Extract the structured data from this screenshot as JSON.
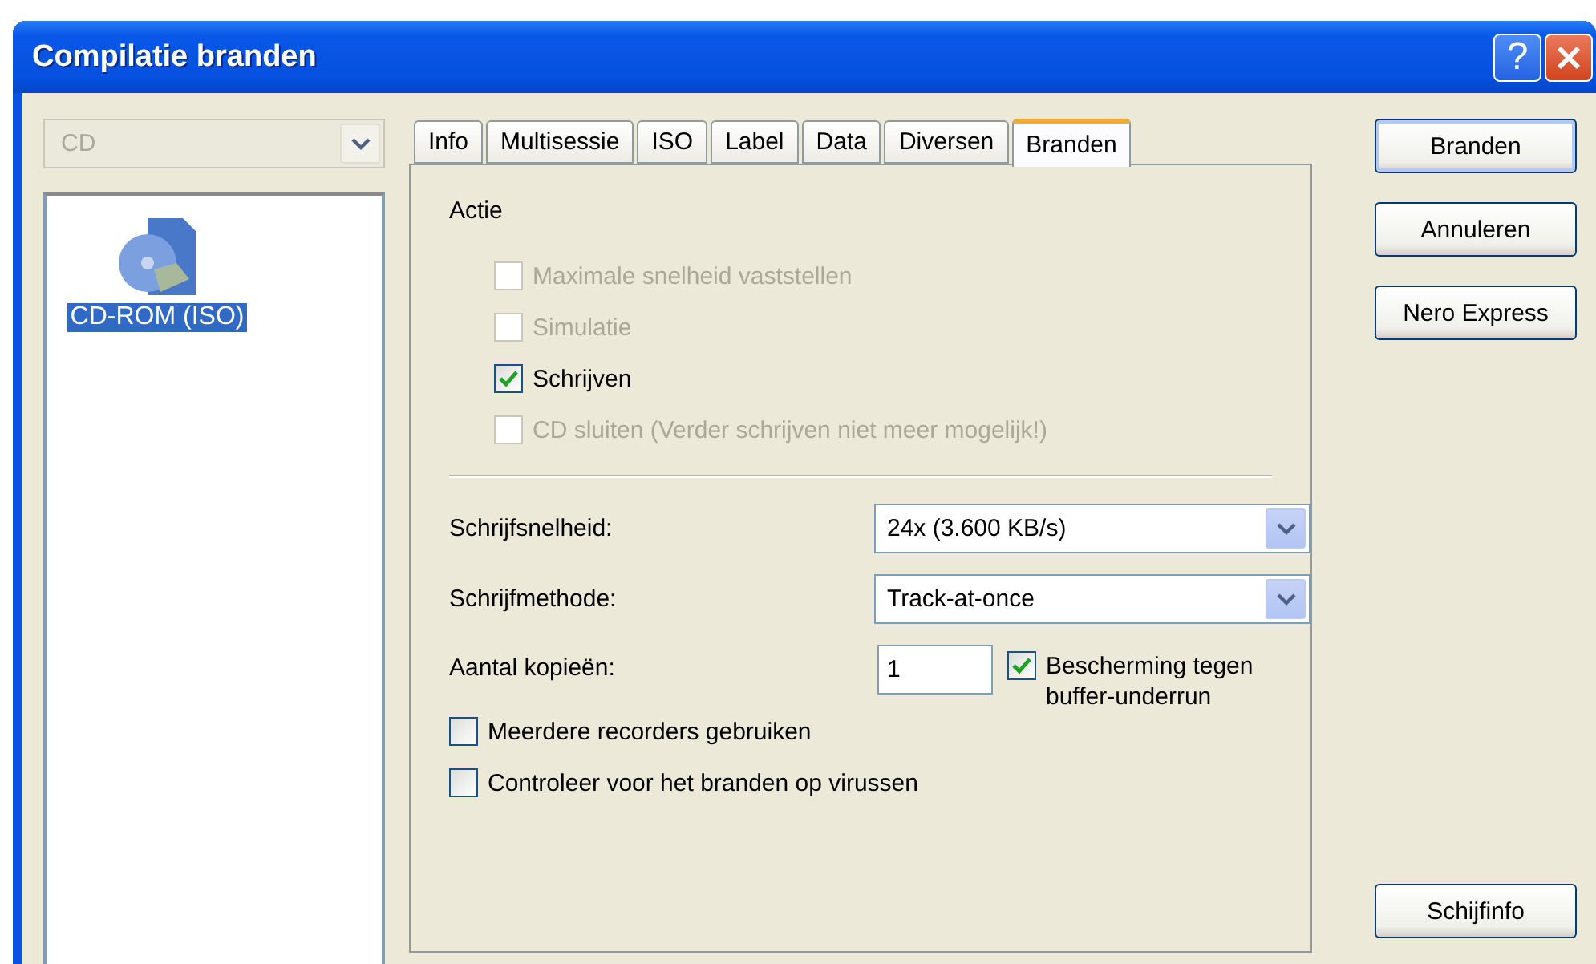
{
  "window": {
    "title": "Compilatie branden",
    "title_buttons": [
      {
        "kind": "help",
        "glyph": "?"
      },
      {
        "kind": "close"
      }
    ]
  },
  "media_select": {
    "value": "CD",
    "disabled": true
  },
  "compilation_list": {
    "items": [
      {
        "label": "CD-ROM (ISO)",
        "selected": true
      }
    ]
  },
  "tabs": [
    {
      "label": "Info",
      "selected": false
    },
    {
      "label": "Multisessie",
      "selected": false
    },
    {
      "label": "ISO",
      "selected": false
    },
    {
      "label": "Label",
      "selected": false
    },
    {
      "label": "Data",
      "selected": false
    },
    {
      "label": "Diversen",
      "selected": false
    },
    {
      "label": "Branden",
      "selected": true
    }
  ],
  "burn_panel": {
    "section_title": "Actie",
    "actions": [
      {
        "label": "Maximale snelheid vaststellen",
        "checked": false,
        "disabled": true
      },
      {
        "label": "Simulatie",
        "checked": false,
        "disabled": true
      },
      {
        "label": "Schrijven",
        "checked": true,
        "disabled": false
      },
      {
        "label": "CD sluiten (Verder schrijven niet meer mogelijk!)",
        "checked": false,
        "disabled": true
      }
    ],
    "write_speed": {
      "label": "Schrijfsnelheid:",
      "value": "24x (3.600 KB/s)"
    },
    "write_method": {
      "label": "Schrijfmethode:",
      "value": "Track-at-once"
    },
    "copies": {
      "label": "Aantal kopieën:",
      "value": "1"
    },
    "buffer_protection": {
      "label": "Bescherming tegen buffer-underrun",
      "checked": true
    },
    "options": [
      {
        "label": "Meerdere recorders gebruiken",
        "checked": false
      },
      {
        "label": "Controleer voor het branden op virussen",
        "checked": false
      }
    ]
  },
  "buttons": [
    {
      "label": "Branden",
      "default": true
    },
    {
      "label": "Annuleren",
      "default": false
    },
    {
      "label": "Nero Express",
      "default": false
    },
    {
      "label": "Schijfinfo",
      "default": false
    }
  ]
}
